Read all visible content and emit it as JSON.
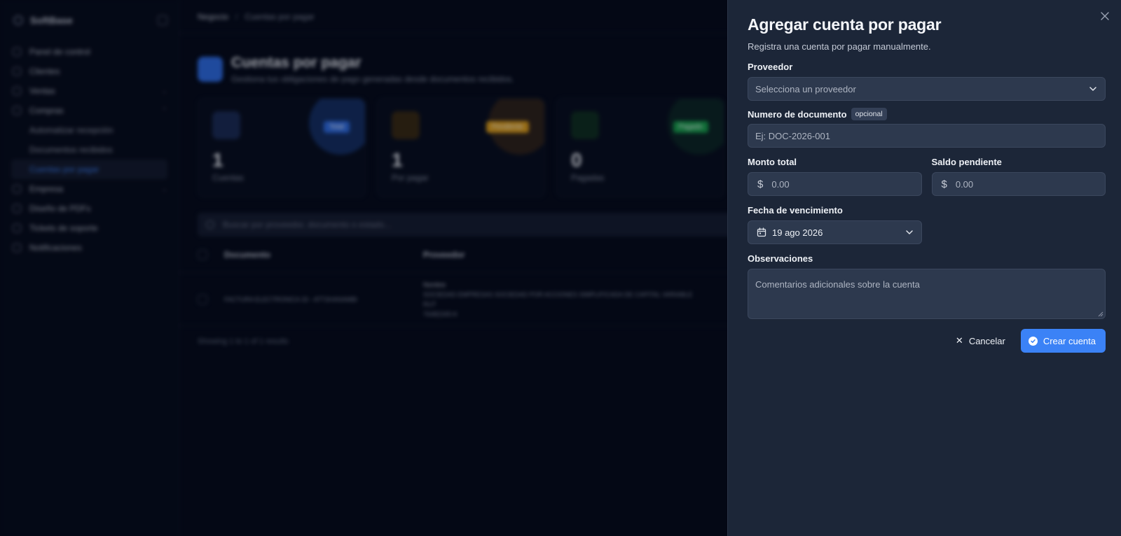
{
  "background": {
    "brand": "SoftBase",
    "sidebar_items": [
      {
        "label": "Panel de control",
        "chevron": false
      },
      {
        "label": "Clientes",
        "chevron": false
      },
      {
        "label": "Ventas",
        "chevron": true
      },
      {
        "label": "Compras",
        "chevron": true
      }
    ],
    "sidebar_subitems": [
      "Automatizar recepción",
      "Documentos recibidos",
      "Cuentas por pagar"
    ],
    "sidebar_items_after": [
      {
        "label": "Empresa",
        "chevron": true
      },
      {
        "label": "Diseño de PDFs",
        "chevron": false
      },
      {
        "label": "Tickets de soporte",
        "chevron": false
      },
      {
        "label": "Notificaciones",
        "chevron": false
      }
    ],
    "breadcrumb": {
      "root": "Negocio",
      "separator": "/",
      "current": "Cuentas por pagar"
    },
    "page_title": "Cuentas por pagar",
    "page_subtitle": "Gestiona tus obligaciones de pago generadas desde documentos recibidos.",
    "stats": [
      {
        "value": "1",
        "label": "Cuentas",
        "badge": "Total",
        "color": "#2f6fe8"
      },
      {
        "value": "1",
        "label": "Por pagar",
        "badge": "Pendiente",
        "color": "#e6a317"
      },
      {
        "value": "0",
        "label": "Pagadas",
        "badge": "Pagado",
        "color": "#16a34a"
      }
    ],
    "search_placeholder": "Buscar por proveedor, documento o estado...",
    "table_headers": [
      "Documento",
      "Proveedor"
    ],
    "table_row": {
      "document": "FACTURA ELECTRONICA 33 - ATT3HANAMBI",
      "provider_label": "Nombre",
      "provider_name": "SOCIEDAD EMPRESAS SOCIEDAD POR ACCIONES SIMPLIFICADA DE CAPITAL VARIABLE",
      "provider_rut": "RUT",
      "provider_id": "76482345-K"
    },
    "showing_text": "Showing 1 to 1 of 1 results"
  },
  "sheet": {
    "title": "Agregar cuenta por pagar",
    "description": "Registra una cuenta por pagar manualmente.",
    "close_icon": "close-icon",
    "proveedor": {
      "label": "Proveedor",
      "placeholder": "Selecciona un proveedor"
    },
    "documento": {
      "label": "Numero de documento",
      "badge": "opcional",
      "placeholder": "Ej: DOC-2026-001"
    },
    "monto_total": {
      "label": "Monto total",
      "currency_symbol": "$",
      "placeholder": "0.00"
    },
    "saldo_pendiente": {
      "label": "Saldo pendiente",
      "currency_symbol": "$",
      "placeholder": "0.00"
    },
    "fecha": {
      "label": "Fecha de vencimiento",
      "value": "19 ago 2026"
    },
    "observaciones": {
      "label": "Observaciones",
      "placeholder": "Comentarios adicionales sobre la cuenta"
    },
    "actions": {
      "cancel": "Cancelar",
      "submit": "Crear cuenta"
    },
    "colors": {
      "panel_bg": "#1c2638",
      "input_bg": "#2d394e",
      "primary": "#3b82f6"
    }
  }
}
